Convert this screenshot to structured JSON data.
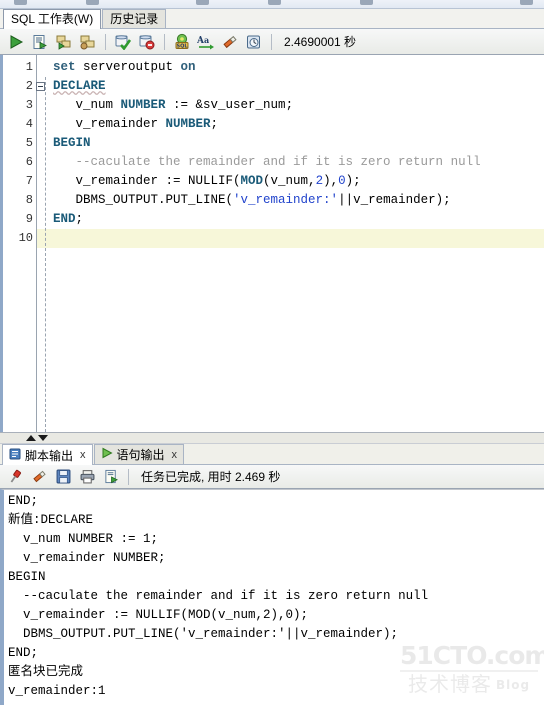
{
  "window": {
    "app": "SQL Developer"
  },
  "tabs": [
    {
      "label": "SQL 工作表(W)",
      "active": true
    },
    {
      "label": "历史记录",
      "active": false
    }
  ],
  "toolbar": {
    "buttons": [
      {
        "name": "run-statement-icon",
        "title": "执行语句"
      },
      {
        "name": "run-script-icon",
        "title": "运行脚本"
      },
      {
        "name": "explain-plan-icon",
        "title": "自动跟踪"
      },
      {
        "name": "autotrace-icon",
        "title": "解释计划"
      },
      {
        "name": "commit-icon",
        "title": "提交"
      },
      {
        "name": "rollback-icon",
        "title": "回退"
      },
      {
        "name": "sql-history-icon",
        "title": "SQL 历史记录"
      },
      {
        "name": "format-icon",
        "title": "格式化"
      },
      {
        "name": "clear-icon",
        "title": "清除"
      },
      {
        "name": "timer-icon",
        "title": "计时"
      }
    ],
    "timing": "2.4690001 秒"
  },
  "editor": {
    "current_line": 10,
    "line_numbers": [
      "1",
      "2",
      "3",
      "4",
      "5",
      "6",
      "7",
      "8",
      "9",
      "10"
    ],
    "fold_at_line": 2,
    "lines": [
      {
        "n": "1",
        "tokens": [
          {
            "t": "set",
            "c": "kw"
          },
          {
            "t": " serveroutput ",
            "c": ""
          },
          {
            "t": "on",
            "c": "kw"
          }
        ]
      },
      {
        "n": "2",
        "tokens": [
          {
            "t": "DECLARE",
            "c": "kw2 squig"
          }
        ]
      },
      {
        "n": "3",
        "tokens": [
          {
            "t": "   v_num ",
            "c": ""
          },
          {
            "t": "NUMBER",
            "c": "kw2"
          },
          {
            "t": " := ",
            "c": ""
          },
          {
            "t": "&sv_user_num",
            "c": "sub"
          },
          {
            "t": ";",
            "c": ""
          }
        ]
      },
      {
        "n": "4",
        "tokens": [
          {
            "t": "   v_remainder ",
            "c": ""
          },
          {
            "t": "NUMBER",
            "c": "kw2"
          },
          {
            "t": ";",
            "c": ""
          }
        ]
      },
      {
        "n": "5",
        "tokens": [
          {
            "t": "BEGIN",
            "c": "kw2"
          }
        ]
      },
      {
        "n": "6",
        "tokens": [
          {
            "t": "   --caculate the remainder and if it is zero return null",
            "c": "cmt"
          }
        ]
      },
      {
        "n": "7",
        "tokens": [
          {
            "t": "   v_remainder := NULLIF(",
            "c": ""
          },
          {
            "t": "MOD",
            "c": "kw2"
          },
          {
            "t": "(v_num,",
            "c": ""
          },
          {
            "t": "2",
            "c": "num"
          },
          {
            "t": "),",
            "c": ""
          },
          {
            "t": "0",
            "c": "num"
          },
          {
            "t": ");",
            "c": ""
          }
        ]
      },
      {
        "n": "8",
        "tokens": [
          {
            "t": "   DBMS_OUTPUT.PUT_LINE(",
            "c": ""
          },
          {
            "t": "'v_remainder:'",
            "c": "str"
          },
          {
            "t": "||v_remainder);",
            "c": ""
          }
        ]
      },
      {
        "n": "9",
        "tokens": [
          {
            "t": "END",
            "c": "kw2"
          },
          {
            "t": ";",
            "c": ""
          }
        ]
      },
      {
        "n": "10",
        "tokens": [
          {
            "t": " ",
            "c": ""
          }
        ]
      }
    ]
  },
  "splitter": {
    "expand_icon": "triangle-up-icon",
    "collapse_icon": "triangle-down-icon"
  },
  "output": {
    "tabs": [
      {
        "label": "脚本输出",
        "icon": "script-output-icon",
        "close": "x",
        "active": true
      },
      {
        "label": "语句输出",
        "icon": "statement-output-icon",
        "close": "x",
        "active": false
      }
    ],
    "toolbar": [
      {
        "name": "pin-icon",
        "title": "固定"
      },
      {
        "name": "eraser-icon",
        "title": "清除"
      },
      {
        "name": "save-icon",
        "title": "保存"
      },
      {
        "name": "print-icon",
        "title": "打印"
      },
      {
        "name": "run-script-output-icon",
        "title": "运行脚本"
      }
    ],
    "status": "任务已完成, 用时 2.469 秒",
    "lines": [
      "END;",
      "新值:DECLARE",
      "  v_num NUMBER := 1;",
      "  v_remainder NUMBER;",
      "BEGIN",
      "  --caculate the remainder and if it is zero return null",
      "  v_remainder := NULLIF(MOD(v_num,2),0);",
      "  DBMS_OUTPUT.PUT_LINE('v_remainder:'||v_remainder);",
      "END;",
      "匿名块已完成",
      "v_remainder:1"
    ]
  },
  "watermark": {
    "line1": "51CTO.com",
    "line2": "技术博客",
    "badge": "Blog"
  },
  "colors": {
    "keyword": "#2f5f7a",
    "string": "#2244cc",
    "comment": "#9a9a9a",
    "current_line_bg": "#f7f7d9",
    "scrollbar": "#8fa8c8"
  }
}
